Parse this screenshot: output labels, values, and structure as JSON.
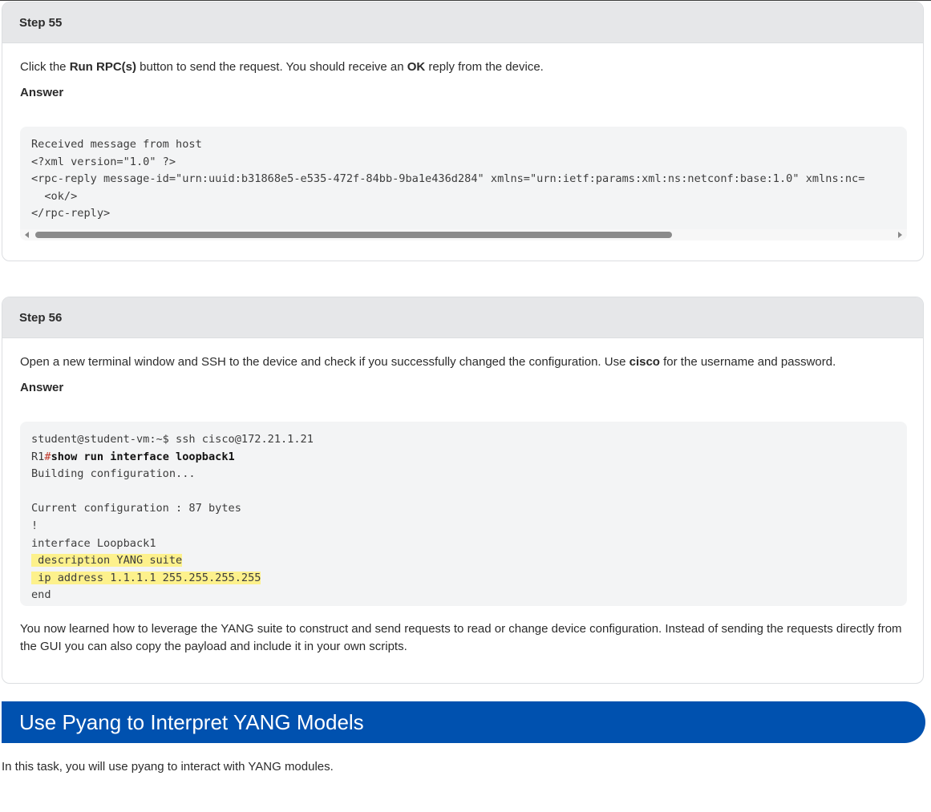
{
  "step55": {
    "title": "Step 55",
    "instr": {
      "p1": "Click the ",
      "b1": "Run RPC(s)",
      "p2": " button to send the request. You should receive an ",
      "b2": "OK",
      "p3": " reply from the device."
    },
    "answer_label": "Answer",
    "code_lines": [
      "Received message from host",
      "<?xml version=\"1.0\" ?>",
      "<rpc-reply message-id=\"urn:uuid:b31868e5-e535-472f-84bb-9ba1e436d284\" xmlns=\"urn:ietf:params:xml:ns:netconf:base:1.0\" xmlns:nc=",
      "  <ok/>",
      "</rpc-reply>"
    ]
  },
  "step56": {
    "title": "Step 56",
    "instr": {
      "p1": "Open a new terminal window and SSH to the device and check if you successfully changed the configuration. Use ",
      "b1": "cisco",
      "p2": " for the username and password."
    },
    "answer_label": "Answer",
    "code": {
      "line1": "student@student-vm:~$ ssh cisco@172.21.1.21",
      "line2_prefix": "R1",
      "line2_hash": "#",
      "line2_cmd": "show run interface loopback1",
      "line3": "Building configuration...",
      "line4": "",
      "line5": "Current configuration : 87 bytes",
      "line6": "!",
      "line7": "interface Loopback1",
      "line8": " description YANG suite",
      "line9": " ip address 1.1.1.1 255.255.255.255",
      "line10": "end"
    },
    "summary": "You now learned how to leverage the YANG suite to construct and send requests to read or change device configuration. Instead of sending the requests directly from the GUI you can also copy the payload and include it in your own scripts."
  },
  "section": {
    "title": "Use Pyang to Interpret YANG Models",
    "intro": "In this task, you will use pyang to interact with YANG modules."
  }
}
